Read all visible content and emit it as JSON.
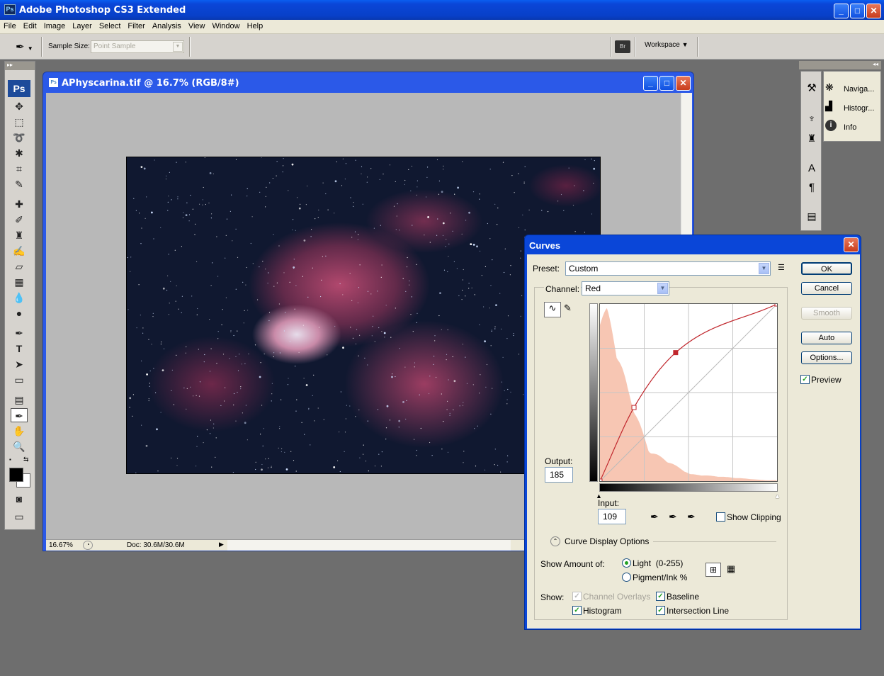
{
  "app": {
    "title": "Adobe Photoshop CS3 Extended",
    "logo": "Ps"
  },
  "menu": [
    "File",
    "Edit",
    "Image",
    "Layer",
    "Select",
    "Filter",
    "Analysis",
    "View",
    "Window",
    "Help"
  ],
  "options": {
    "sample_size_label": "Sample Size:",
    "sample_size_value": "Point Sample",
    "workspace_label": "Workspace",
    "bridge_icon": "Br"
  },
  "document": {
    "title": "APhyscarina.tif @ 16.7% (RGB/8#)",
    "zoom": "16.67%",
    "doc_info": "Doc: 30.6M/30.6M"
  },
  "panels": [
    {
      "name": "Naviga...",
      "icon": "navigator-icon"
    },
    {
      "name": "Histogr...",
      "icon": "histogram-icon"
    },
    {
      "name": "Info",
      "icon": "info-icon"
    }
  ],
  "curves": {
    "title": "Curves",
    "preset_label": "Preset:",
    "preset_value": "Custom",
    "channel_label": "Channel:",
    "channel_value": "Red",
    "output_label": "Output:",
    "output_value": "185",
    "input_label": "Input:",
    "input_value": "109",
    "show_clipping": "Show Clipping",
    "buttons": {
      "ok": "OK",
      "cancel": "Cancel",
      "smooth": "Smooth",
      "auto": "Auto",
      "options": "Options..."
    },
    "preview_label": "Preview",
    "display_options_label": "Curve Display Options",
    "show_amount_label": "Show Amount of:",
    "light_label": "Light  (0-255)",
    "pigment_label": "Pigment/Ink %",
    "show_label": "Show:",
    "channel_overlays": "Channel Overlays",
    "baseline": "Baseline",
    "histogram": "Histogram",
    "intersection_line": "Intersection Line",
    "curve_points": [
      [
        0,
        0
      ],
      [
        49,
        106
      ],
      [
        109,
        185
      ],
      [
        255,
        255
      ]
    ],
    "curve_color": "#c0262c",
    "histogram_color": "#f7c6b3"
  }
}
